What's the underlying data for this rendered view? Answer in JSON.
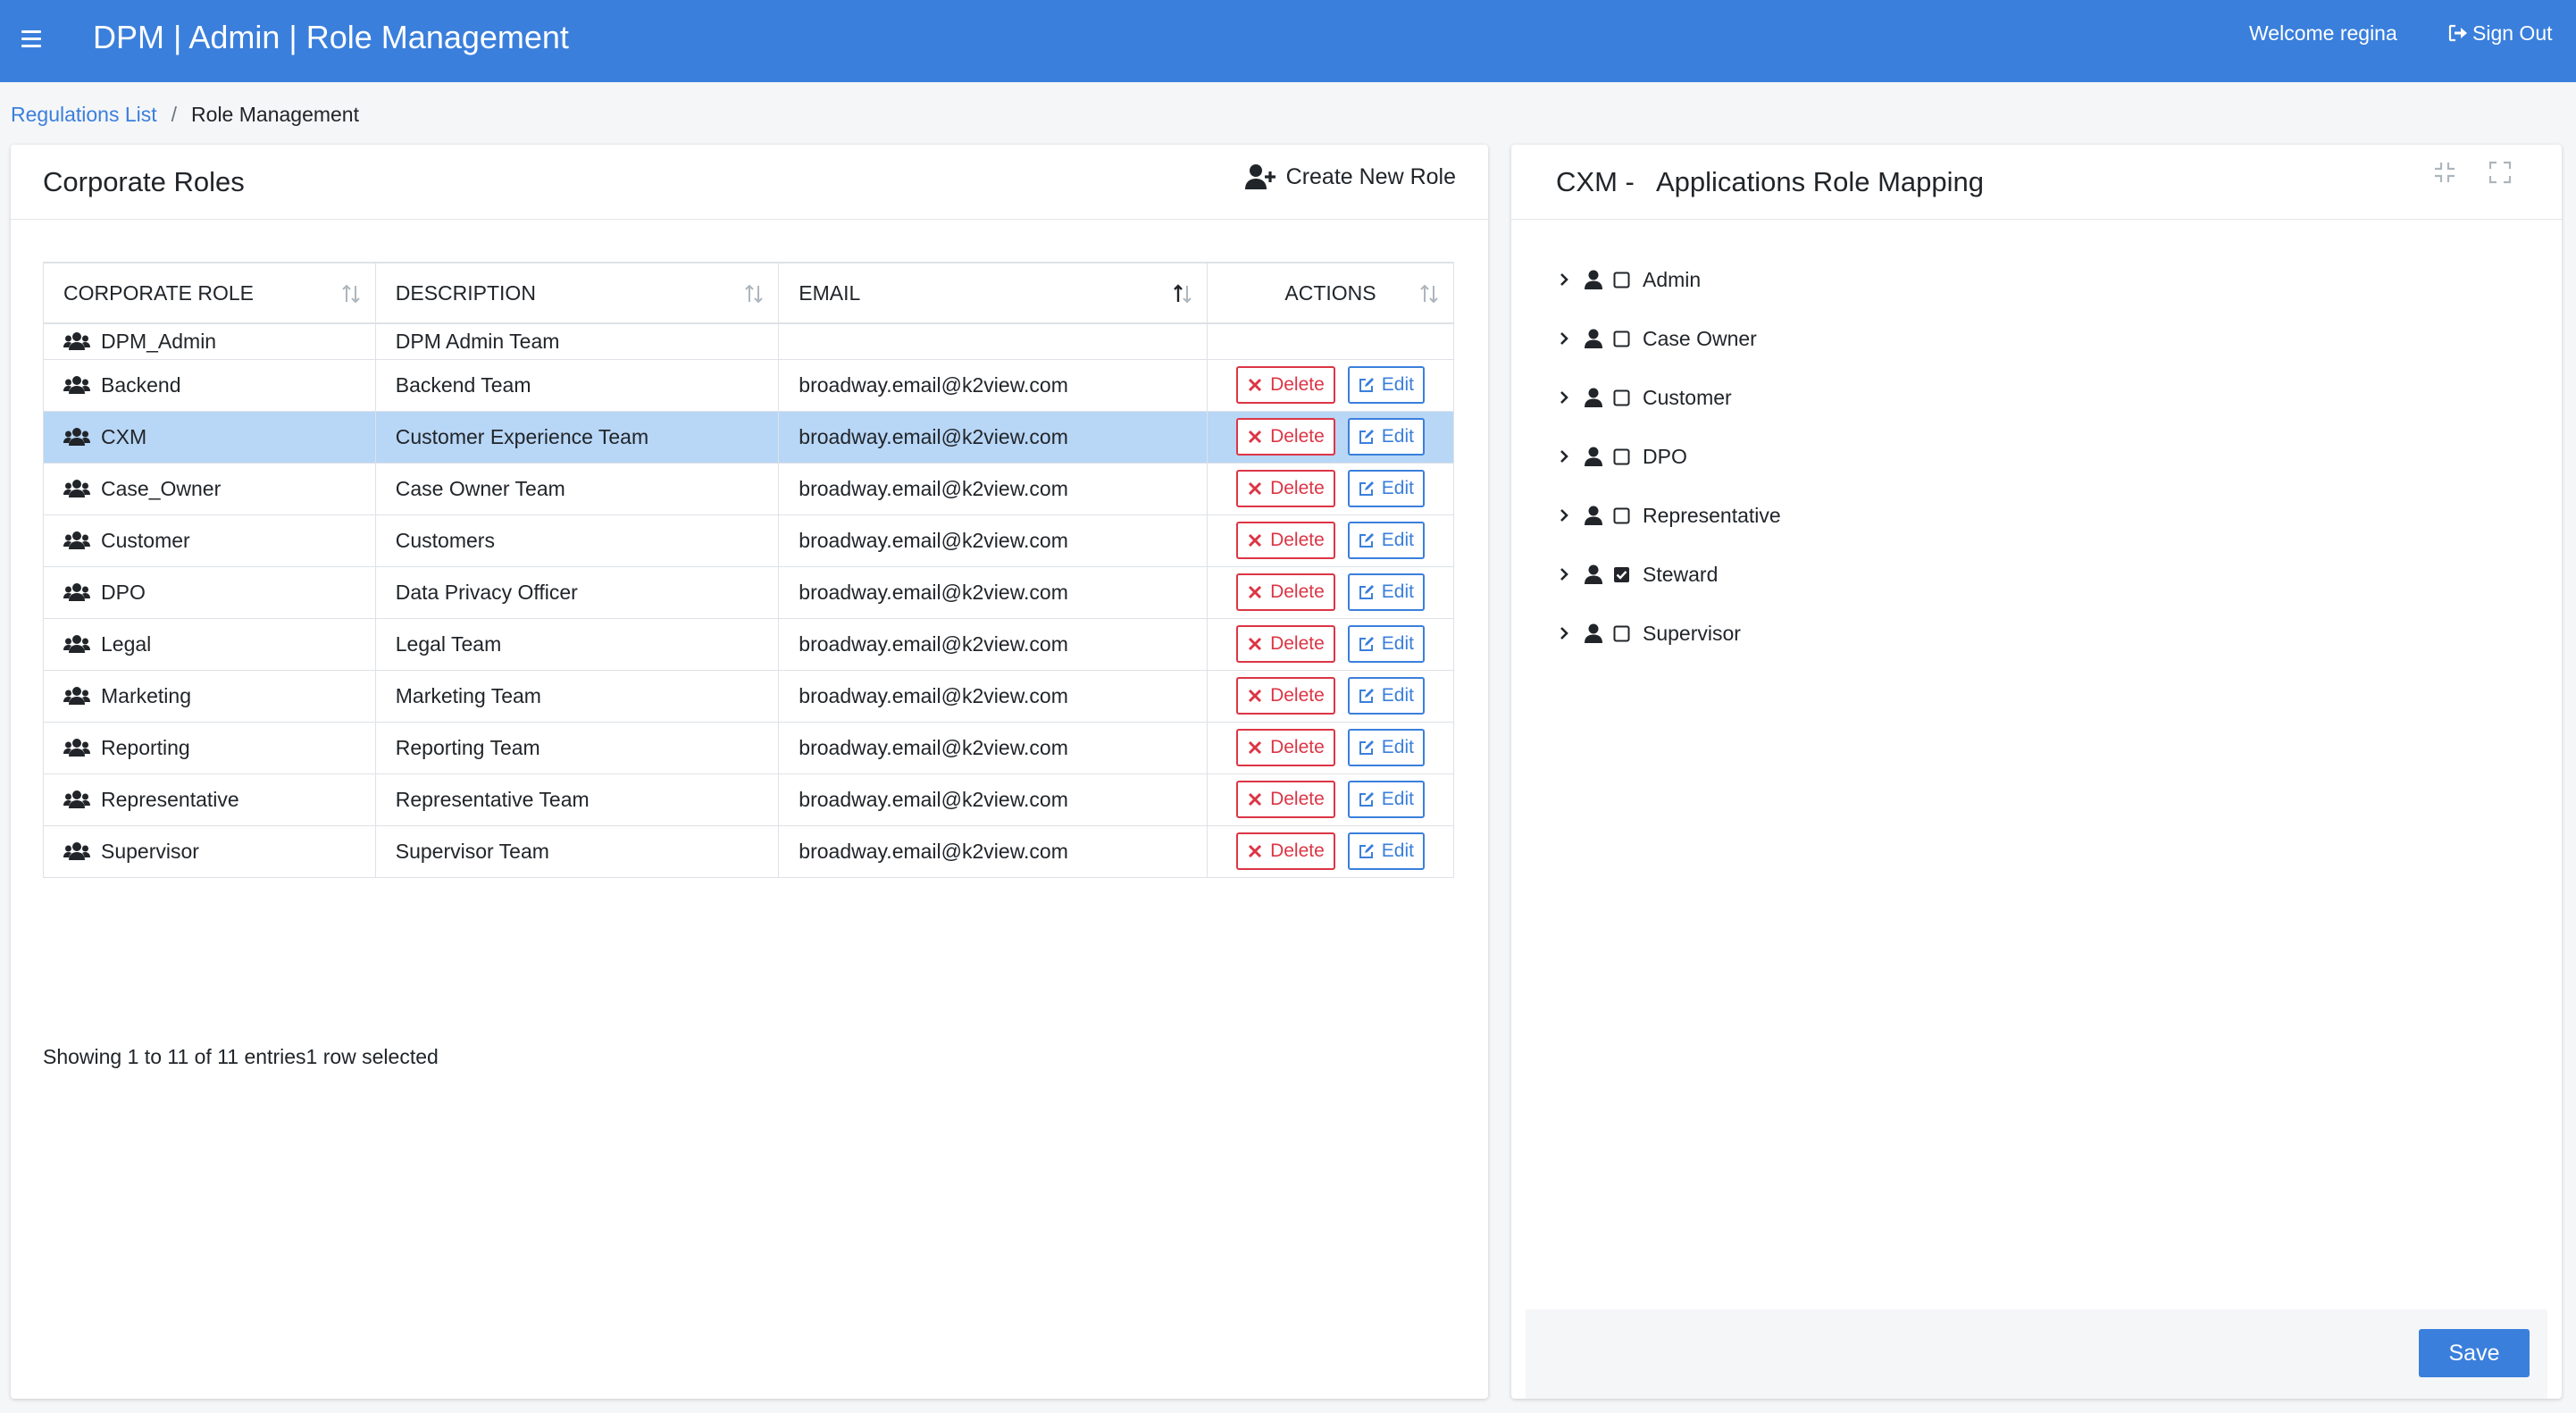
{
  "app": {
    "title": "DPM | Admin | Role Management",
    "welcome": "Welcome regina",
    "signout": "Sign Out"
  },
  "breadcrumb": {
    "link": "Regulations List",
    "separator": "/",
    "current": "Role Management"
  },
  "left": {
    "title": "Corporate Roles",
    "create_label": "Create New Role",
    "columns": [
      "CORPORATE ROLE",
      "DESCRIPTION",
      "EMAIL",
      "ACTIONS"
    ],
    "delete_label": "Delete",
    "edit_label": "Edit",
    "rows": [
      {
        "role": "DPM_Admin",
        "description": "DPM Admin Team",
        "email": ""
      },
      {
        "role": "Backend",
        "description": "Backend Team",
        "email": "broadway.email@k2view.com"
      },
      {
        "role": "CXM",
        "description": "Customer Experience Team",
        "email": "broadway.email@k2view.com"
      },
      {
        "role": "Case_Owner",
        "description": "Case Owner Team",
        "email": "broadway.email@k2view.com"
      },
      {
        "role": "Customer",
        "description": "Customers",
        "email": "broadway.email@k2view.com"
      },
      {
        "role": "DPO",
        "description": "Data Privacy Officer",
        "email": "broadway.email@k2view.com"
      },
      {
        "role": "Legal",
        "description": "Legal Team",
        "email": "broadway.email@k2view.com"
      },
      {
        "role": "Marketing",
        "description": "Marketing Team",
        "email": "broadway.email@k2view.com"
      },
      {
        "role": "Reporting",
        "description": "Reporting Team",
        "email": "broadway.email@k2view.com"
      },
      {
        "role": "Representative",
        "description": "Representative Team",
        "email": "broadway.email@k2view.com"
      },
      {
        "role": "Supervisor",
        "description": "Supervisor Team",
        "email": "broadway.email@k2view.com"
      }
    ],
    "info": "Showing 1 to 11 of 11 entries1 row selected"
  },
  "right": {
    "title": "CXM -   Applications Role Mapping",
    "items": [
      {
        "label": "Admin",
        "checked": false
      },
      {
        "label": "Case Owner",
        "checked": false
      },
      {
        "label": "Customer",
        "checked": false
      },
      {
        "label": "DPO",
        "checked": false
      },
      {
        "label": "Representative",
        "checked": false
      },
      {
        "label": "Steward",
        "checked": true
      },
      {
        "label": "Supervisor",
        "checked": false
      }
    ],
    "save_label": "Save"
  },
  "colors": {
    "primary": "#3a7fdc",
    "danger": "#dc3545",
    "selected_row": "#b8d6f6"
  }
}
